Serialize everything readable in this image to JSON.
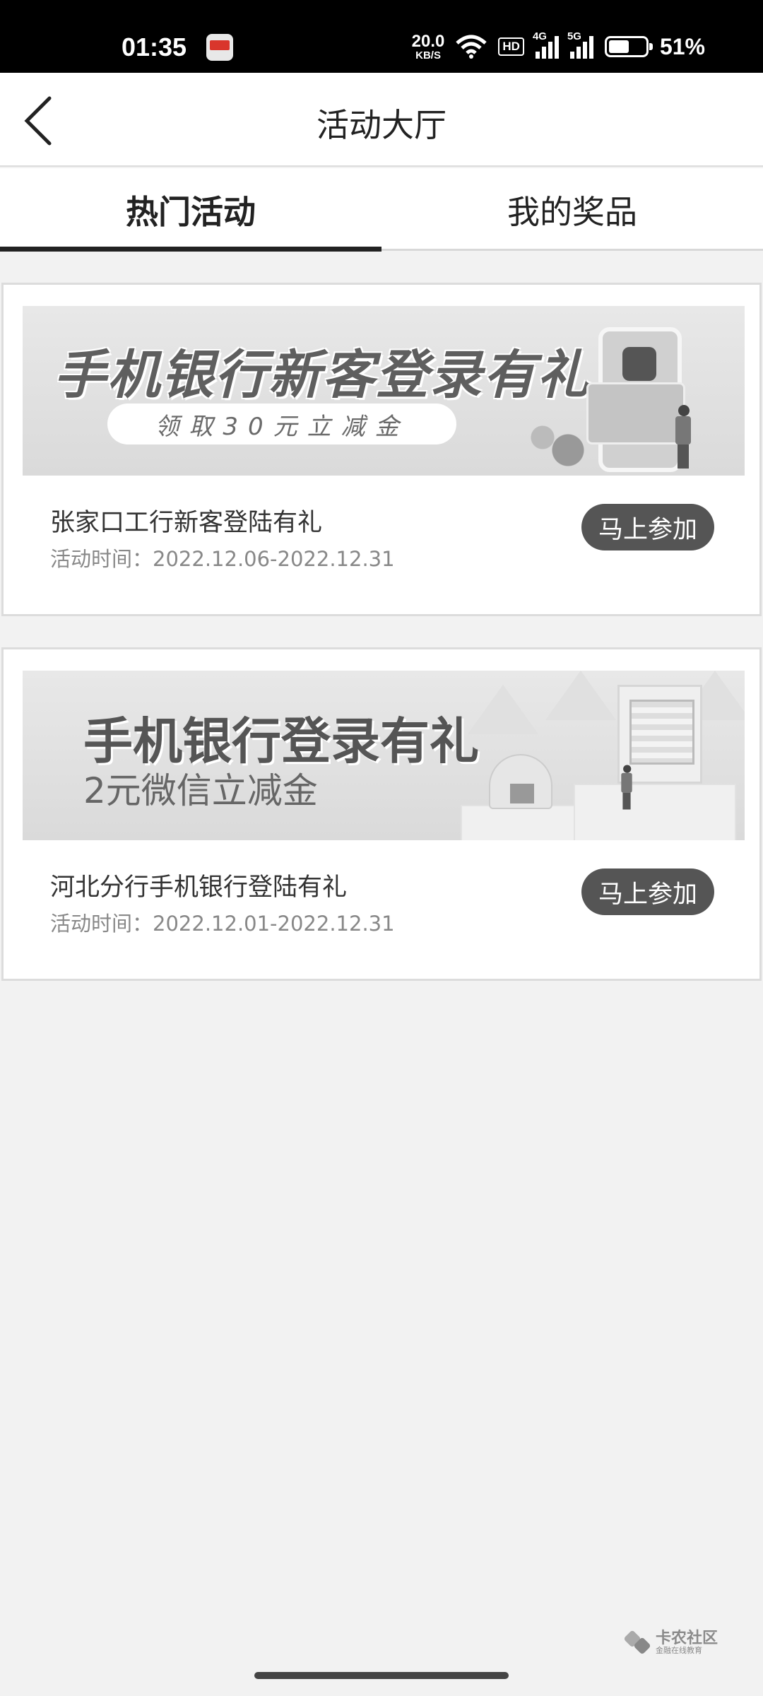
{
  "status_bar": {
    "time": "01:35",
    "net_speed_value": "20.0",
    "net_speed_unit": "KB/S",
    "hd_label": "HD",
    "sim1_label": "4G",
    "sim2_label": "5G",
    "battery_percent": "51%",
    "battery_level": 0.51
  },
  "header": {
    "title": "活动大厅"
  },
  "tabs": [
    {
      "label": "热门活动",
      "active": true
    },
    {
      "label": "我的奖品",
      "active": false
    }
  ],
  "activities": [
    {
      "banner_title": "手机银行新客登录有礼",
      "banner_subtitle": "领取30元立减金",
      "title": "张家口工行新客登陆有礼",
      "time_label": "活动时间：",
      "time_range": "2022.12.06-2022.12.31",
      "button_label": "马上参加"
    },
    {
      "banner_title": "手机银行登录有礼",
      "banner_subtitle": "2元微信立减金",
      "title": "河北分行手机银行登陆有礼",
      "time_label": "活动时间：",
      "time_range": "2022.12.01-2022.12.31",
      "button_label": "马上参加"
    }
  ],
  "watermark": {
    "name": "卡农社区",
    "tagline": "金融在线教育"
  },
  "colors": {
    "status_bar_bg": "#000000",
    "page_bg": "#f2f2f2",
    "button_bg": "#555555",
    "tab_indicator": "#222222"
  }
}
